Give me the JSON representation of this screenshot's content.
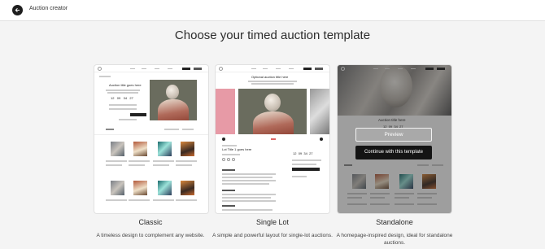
{
  "header": {
    "title": "Auction creator",
    "back_icon": "arrow-left-icon"
  },
  "heading": "Choose your timed auction template",
  "templates": [
    {
      "name": "Classic",
      "description": "A timeless design to complement any website.",
      "preview": {
        "title": "Auction title goes here",
        "countdown": [
          "12",
          "09",
          "34",
          "27"
        ]
      }
    },
    {
      "name": "Single Lot",
      "description": "A simple and powerful layout for single-lot auctions.",
      "preview": {
        "title": "Optional auction title here",
        "lot_title": "Lot Title 1 goes here",
        "countdown": [
          "12",
          "09",
          "34",
          "27"
        ]
      }
    },
    {
      "name": "Standalone",
      "description": "A homepage-inspired design, ideal for standalone auctions.",
      "selected": true,
      "preview": {
        "title": "Auction title here",
        "countdown": [
          "12",
          "09",
          "34",
          "27"
        ]
      },
      "actions": {
        "preview_label": "Preview",
        "continue_label": "Continue with this template"
      }
    }
  ],
  "colors": {
    "background": "#f4f4f4",
    "primary_button": "#141414",
    "overlay": "rgba(40,40,40,0.45)"
  }
}
